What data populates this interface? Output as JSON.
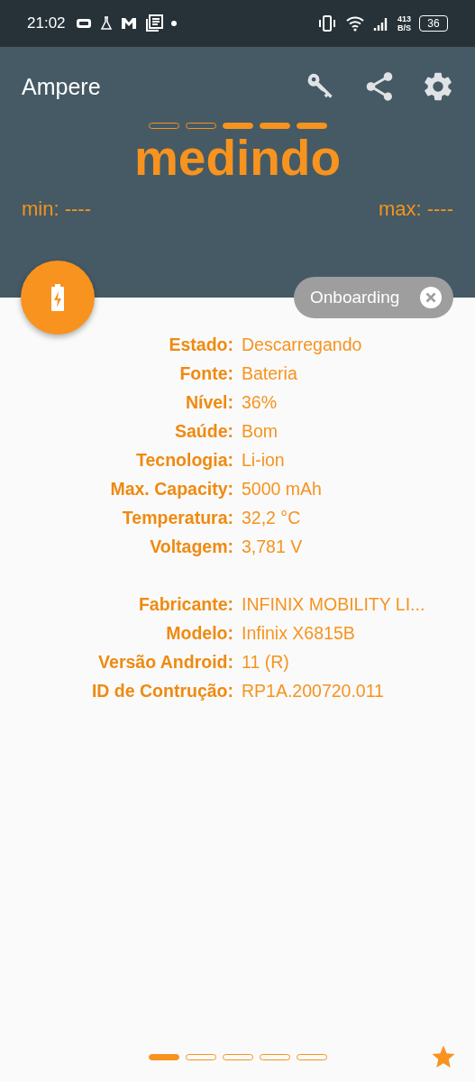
{
  "status_bar": {
    "time": "21:02",
    "net_speed": "413",
    "net_unit": "B/S",
    "battery": "36"
  },
  "app_bar": {
    "title": "Ampere"
  },
  "meter": {
    "segments": [
      {
        "filled": false
      },
      {
        "filled": false
      },
      {
        "filled": true
      },
      {
        "filled": true
      },
      {
        "filled": true
      }
    ],
    "status": "medindo",
    "min": "min: ----",
    "max": "max: ----"
  },
  "chip": {
    "label": "Onboarding"
  },
  "info_groups": [
    [
      {
        "label": "Estado:",
        "value": "Descarregando"
      },
      {
        "label": "Fonte:",
        "value": "Bateria"
      },
      {
        "label": "Nível:",
        "value": "36%"
      },
      {
        "label": "Saúde:",
        "value": "Bom"
      },
      {
        "label": "Tecnologia:",
        "value": "Li-ion"
      },
      {
        "label": "Max. Capacity:",
        "value": "5000 mAh"
      },
      {
        "label": "Temperatura:",
        "value": "32,2 °C"
      },
      {
        "label": "Voltagem:",
        "value": "3,781 V"
      }
    ],
    [
      {
        "label": "Fabricante:",
        "value": "INFINIX MOBILITY LI..."
      },
      {
        "label": "Modelo:",
        "value": "Infinix X6815B"
      },
      {
        "label": "Versão Android:",
        "value": "11 (R)"
      },
      {
        "label": "ID de Contrução:",
        "value": "RP1A.200720.011"
      }
    ]
  ],
  "pager": [
    {
      "selected": true
    },
    {
      "selected": false
    },
    {
      "selected": false
    },
    {
      "selected": false
    },
    {
      "selected": false
    }
  ]
}
